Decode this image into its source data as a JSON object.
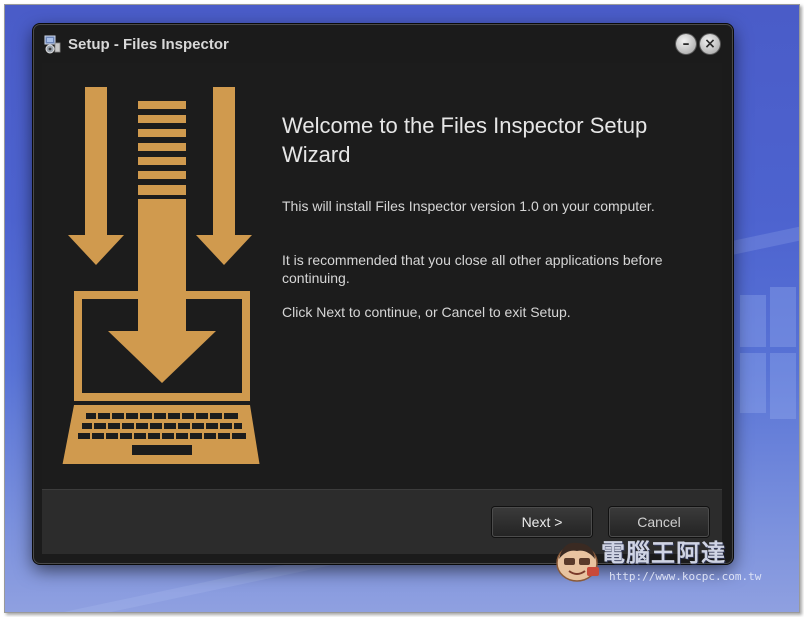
{
  "window": {
    "title": "Setup - Files Inspector",
    "minimize_label": "–",
    "close_label": "×"
  },
  "wizard": {
    "heading": "Welcome to the Files Inspector Setup Wizard",
    "paragraphs": [
      "This will install Files Inspector version 1.0 on your computer.",
      "It is recommended that you close all other applications before continuing.",
      "Click Next to continue, or Cancel to exit Setup."
    ]
  },
  "buttons": {
    "next": "Next >",
    "cancel": "Cancel"
  },
  "watermark": {
    "title": "電腦王阿達",
    "url": "http://www.kocpc.com.tw"
  },
  "colors": {
    "accent": "#d09a4e",
    "window_bg": "#1c1c1c",
    "footer_bg": "#2c2c2c",
    "desktop": "#4d63cf"
  },
  "icons": [
    "setup-app-icon",
    "minimize-icon",
    "close-icon",
    "install-laptop-icon",
    "mascot-icon"
  ]
}
